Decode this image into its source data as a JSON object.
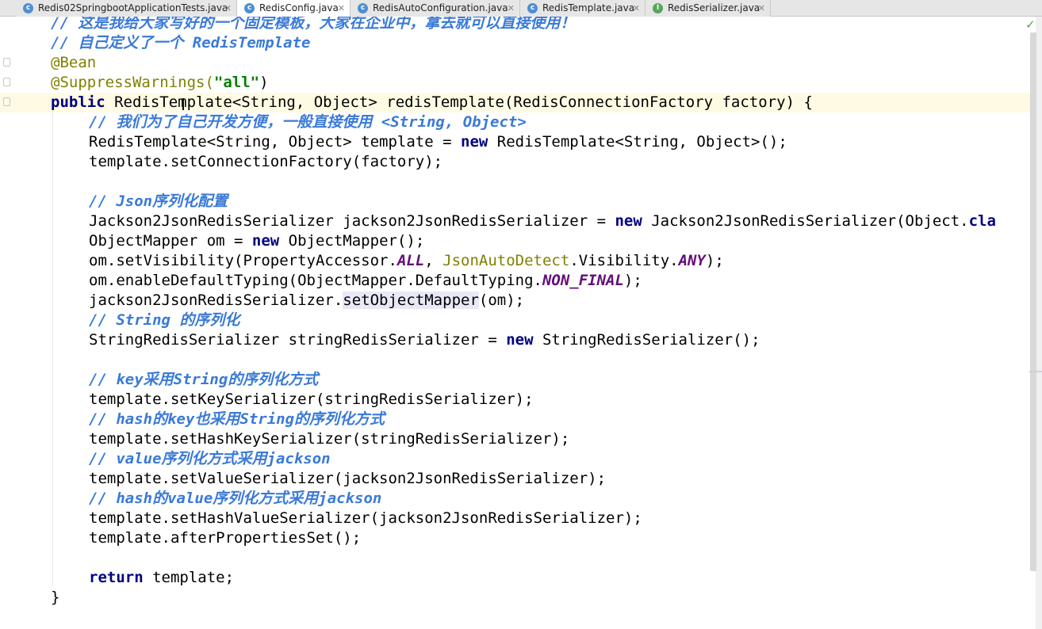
{
  "tabs": [
    {
      "label": "Redis02SpringbootApplicationTests.java",
      "icon": "class-icon",
      "active": false
    },
    {
      "label": "RedisConfig.java",
      "icon": "class-icon",
      "active": true
    },
    {
      "label": "RedisAutoConfiguration.java",
      "icon": "class-icon",
      "active": false
    },
    {
      "label": "RedisTemplate.java",
      "icon": "class-icon",
      "active": false
    },
    {
      "label": "RedisSerializer.java",
      "icon": "interface-icon",
      "active": false
    }
  ],
  "code": {
    "l1": "// 这是我给大家写好的一个固定模板，大家在企业中，拿去就可以直接使用！",
    "l2": "// 自己定义了一个 RedisTemplate",
    "l3": "@Bean",
    "l4_a": "@SuppressWarnings(",
    "l4_b": "\"all\"",
    "l4_c": ")",
    "l5_kw": "public",
    "l5_rest": " RedisTemplate<String, Object> redisTemplate(RedisConnectionFactory factory) {",
    "l6": "// 我们为了自己开发方便，一般直接使用 <String, Object>",
    "l7_a": "RedisTemplate<String, Object> template = ",
    "l7_kw": "new",
    "l7_b": " RedisTemplate<String, Object>();",
    "l8": "template.setConnectionFactory(factory);",
    "l10": "// Json序列化配置",
    "l11_a": "Jackson2JsonRedisSerializer jackson2JsonRedisSerializer = ",
    "l11_kw": "new",
    "l11_b": " Jackson2JsonRedisSerializer(Object.",
    "l11_c": "cla",
    "l12_a": "ObjectMapper om = ",
    "l12_kw": "new",
    "l12_b": " ObjectMapper();",
    "l13_a": "om.setVisibility(PropertyAccessor.",
    "l13_c1": "ALL",
    "l13_b": ", ",
    "l13_an": "JsonAutoDetect",
    "l13_d": ".Visibility.",
    "l13_c2": "ANY",
    "l13_e": ");",
    "l14_a": "om.enableDefaultTyping(ObjectMapper.DefaultTyping.",
    "l14_c": "NON_FINAL",
    "l14_b": ");",
    "l15_a": "jackson2JsonRedisSerializer.",
    "l15_hl": "setObjectMapper",
    "l15_b": "(om);",
    "l16": "// String 的序列化",
    "l17_a": "StringRedisSerializer stringRedisSerializer = ",
    "l17_kw": "new",
    "l17_b": " StringRedisSerializer();",
    "l19": "// key采用String的序列化方式",
    "l20": "template.setKeySerializer(stringRedisSerializer);",
    "l21": "// hash的key也采用String的序列化方式",
    "l22": "template.setHashKeySerializer(stringRedisSerializer);",
    "l23": "// value序列化方式采用jackson",
    "l24": "template.setValueSerializer(jackson2JsonRedisSerializer);",
    "l25": "// hash的value序列化方式采用jackson",
    "l26": "template.setHashValueSerializer(jackson2JsonRedisSerializer);",
    "l27": "template.afterPropertiesSet();",
    "l29_kw": "return",
    "l29_b": " template;",
    "l30": "}"
  },
  "colors": {
    "keyword": "#000080",
    "comment": "#3a7ad8",
    "annotation": "#808000",
    "string": "#008000",
    "constant": "#660e7a"
  }
}
